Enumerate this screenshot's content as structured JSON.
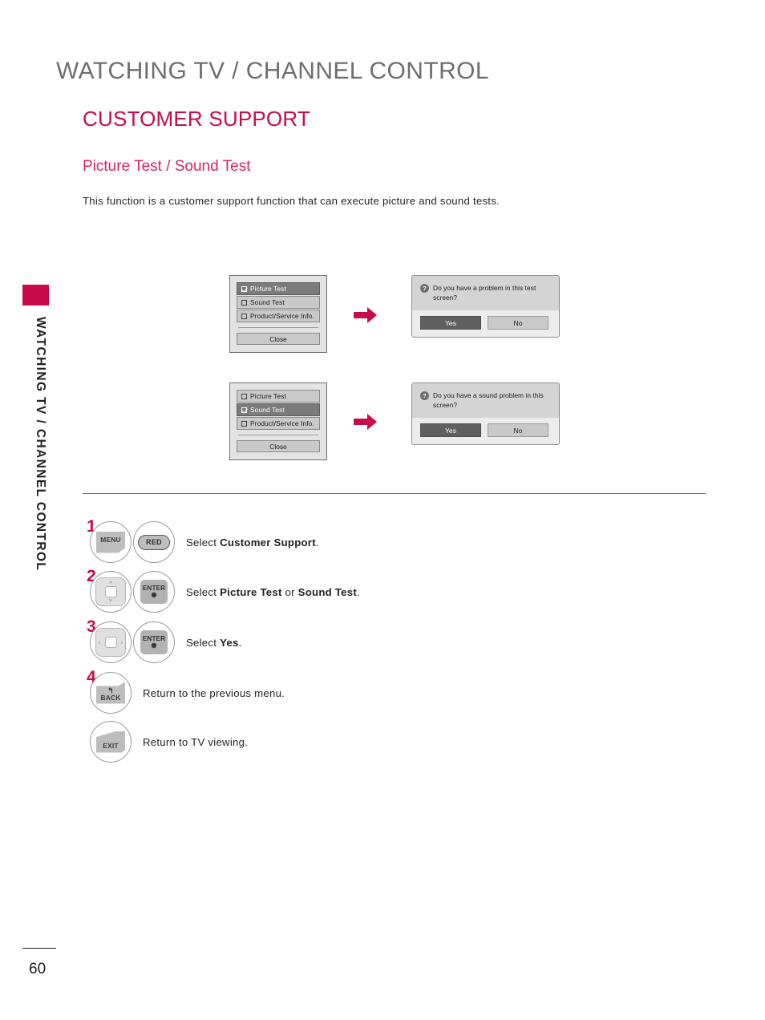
{
  "sidebar": {
    "vertical_label": "WATCHING TV / CHANNEL CONTROL",
    "tab_color": "#c80a4b"
  },
  "header": {
    "chapter_title": "WATCHING TV / CHANNEL CONTROL",
    "section_title": "CUSTOMER SUPPORT",
    "sub_title": "Picture Test  / Sound Test",
    "intro_text": "This function is a customer support function that can execute picture and sound tests."
  },
  "colors": {
    "brand": "#c80a4b",
    "sub_heading": "#d8255f",
    "chapter": "#6d6e70",
    "body": "#231f20"
  },
  "osd": {
    "flow_one": {
      "menu": {
        "items": [
          {
            "label": "Picture Test",
            "checked": true,
            "selected": true
          },
          {
            "label": "Sound Test",
            "checked": false,
            "selected": false
          },
          {
            "label": "Product/Service Info.",
            "checked": false,
            "selected": false
          }
        ],
        "close_label": "Close"
      },
      "dialog": {
        "icon": "question-mark-icon",
        "icon_glyph": "?",
        "message": "Do you have a problem in this test screen?",
        "buttons": [
          {
            "label": "Yes",
            "active": true
          },
          {
            "label": "No",
            "active": false
          }
        ]
      }
    },
    "flow_two": {
      "menu": {
        "items": [
          {
            "label": "Picture Test",
            "checked": false,
            "selected": false
          },
          {
            "label": "Sound Test",
            "checked": true,
            "selected": true
          },
          {
            "label": "Product/Service Info.",
            "checked": false,
            "selected": false
          }
        ],
        "close_label": "Close"
      },
      "dialog": {
        "icon": "question-mark-icon",
        "icon_glyph": "?",
        "message": "Do you have a sound problem in this screen?",
        "buttons": [
          {
            "label": "Yes",
            "active": true
          },
          {
            "label": "No",
            "active": false
          }
        ]
      }
    },
    "arrow_color": "#c80a4b"
  },
  "steps": [
    {
      "number": "1",
      "keys": [
        {
          "type": "fold",
          "label": "MENU",
          "icon": "menu-key-icon"
        },
        {
          "type": "pill",
          "label": "RED",
          "icon": "red-key-icon"
        }
      ],
      "text_parts": [
        {
          "text": "Select ",
          "bold": false
        },
        {
          "text": "Customer Support",
          "bold": true
        },
        {
          "text": ".",
          "bold": false
        }
      ]
    },
    {
      "number": "2",
      "keys": [
        {
          "type": "nav-vertical",
          "label": "",
          "icon": "nav-up-down-icon"
        },
        {
          "type": "enter",
          "label": "ENTER",
          "icon": "enter-key-icon"
        }
      ],
      "text_parts": [
        {
          "text": "Select ",
          "bold": false
        },
        {
          "text": "Picture Test",
          "bold": true
        },
        {
          "text": " or ",
          "bold": false
        },
        {
          "text": "Sound Test",
          "bold": true
        },
        {
          "text": ".",
          "bold": false
        }
      ]
    },
    {
      "number": "3",
      "keys": [
        {
          "type": "nav-horizontal",
          "label": "",
          "icon": "nav-left-right-icon"
        },
        {
          "type": "enter",
          "label": "ENTER",
          "icon": "enter-key-icon"
        }
      ],
      "text_parts": [
        {
          "text": "Select ",
          "bold": false
        },
        {
          "text": "Yes",
          "bold": true
        },
        {
          "text": ".",
          "bold": false
        }
      ]
    },
    {
      "number": "4",
      "keys": [
        {
          "type": "back",
          "label": "BACK",
          "icon": "back-key-icon"
        }
      ],
      "text_parts": [
        {
          "text": "Return to the previous menu.",
          "bold": false
        }
      ]
    },
    {
      "number": "",
      "keys": [
        {
          "type": "exit",
          "label": "EXIT",
          "icon": "exit-key-icon"
        }
      ],
      "text_parts": [
        {
          "text": "Return to TV viewing.",
          "bold": false
        }
      ]
    }
  ],
  "footer": {
    "page_number": "60"
  }
}
